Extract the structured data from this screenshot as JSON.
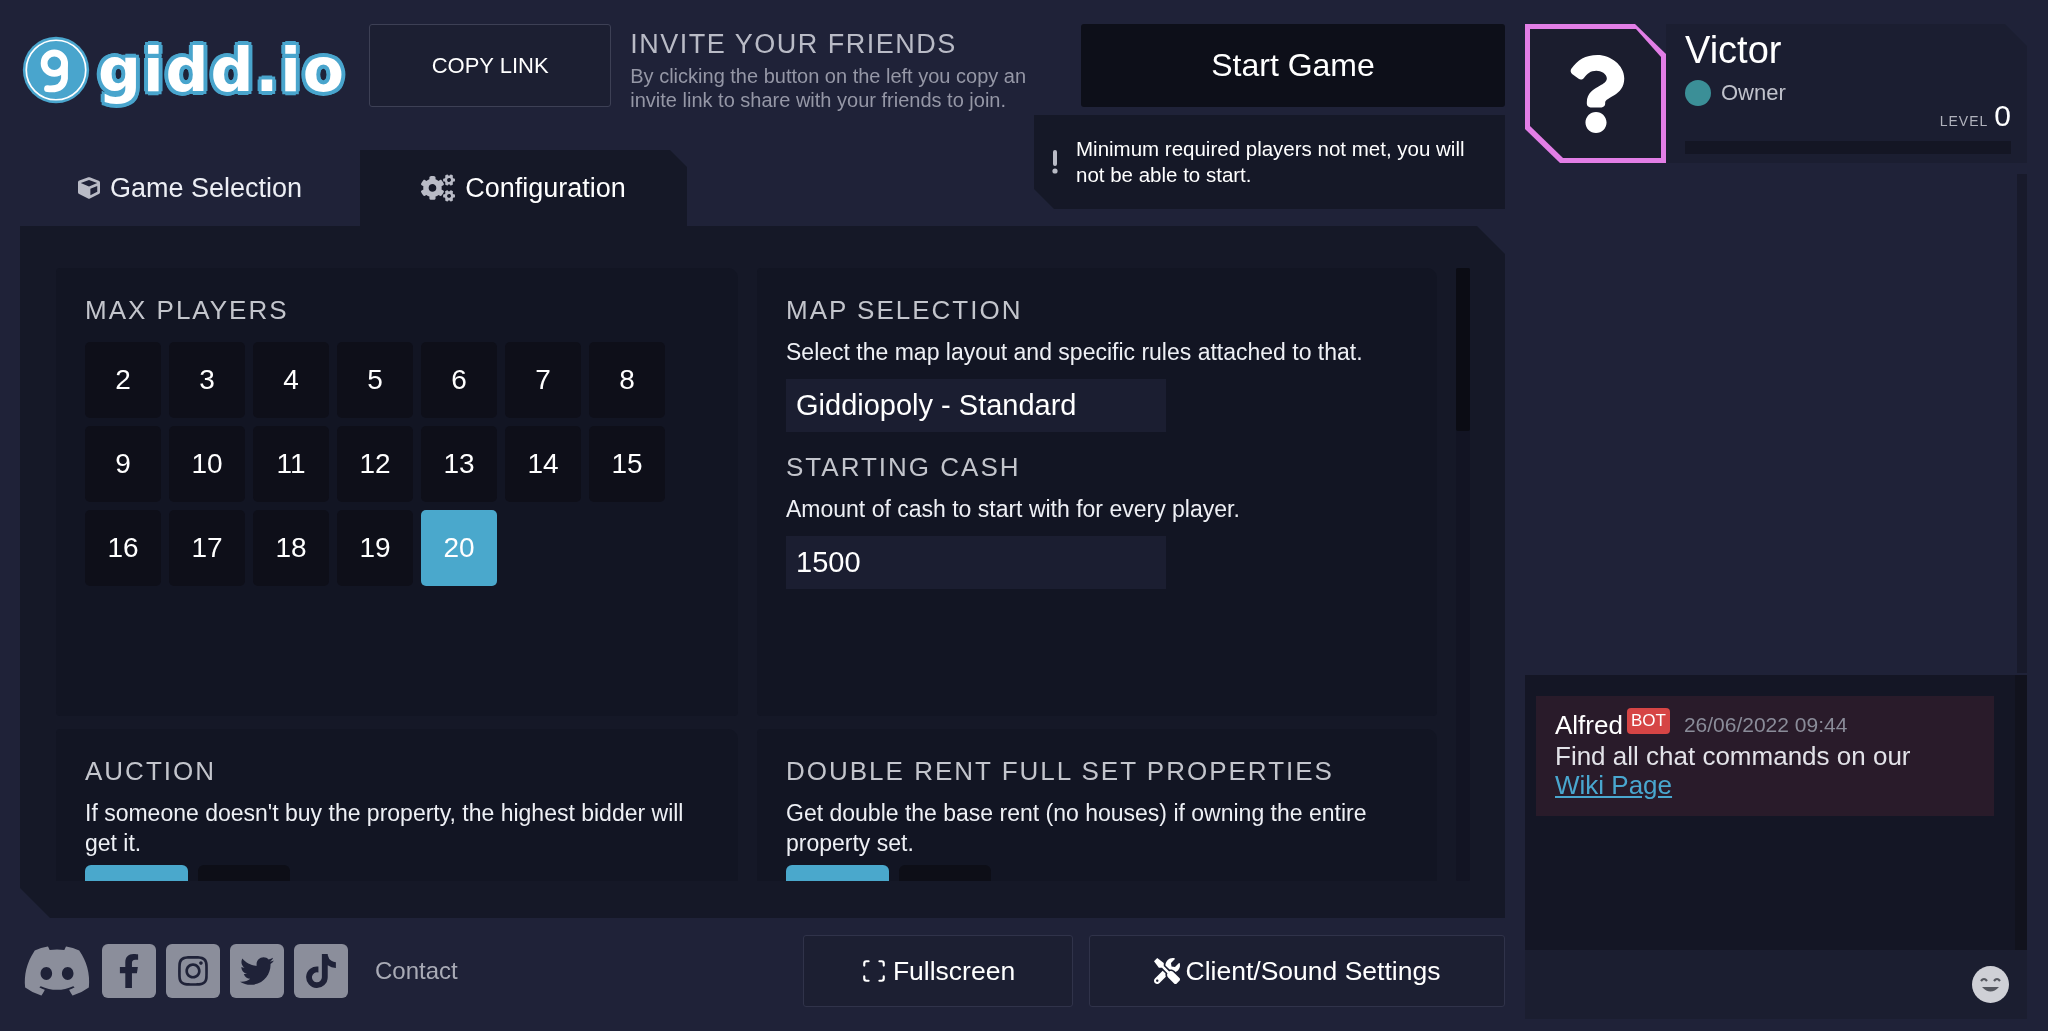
{
  "logo": {
    "text": "gidd.io"
  },
  "invite": {
    "button": "COPY LINK",
    "title": "INVITE YOUR FRIENDS",
    "description": "By clicking the button on the left you copy an invite link to share with your friends to join."
  },
  "start": {
    "button": "Start Game",
    "warning": "Minimum required players not met, you will not be able to start."
  },
  "tabs": [
    {
      "label": "Game Selection",
      "selected": false
    },
    {
      "label": "Configuration",
      "selected": true
    }
  ],
  "cards": [
    {
      "sections": [
        {
          "kind": "choice",
          "title": "MAX PLAYERS",
          "options": [
            {
              "label": "2",
              "selected": false
            },
            {
              "label": "3",
              "selected": false
            },
            {
              "label": "4",
              "selected": false
            },
            {
              "label": "5",
              "selected": false
            },
            {
              "label": "6",
              "selected": false
            },
            {
              "label": "7",
              "selected": false
            },
            {
              "label": "8",
              "selected": false
            },
            {
              "label": "9",
              "selected": false
            },
            {
              "label": "10",
              "selected": false
            },
            {
              "label": "11",
              "selected": false
            },
            {
              "label": "12",
              "selected": false
            },
            {
              "label": "13",
              "selected": false
            },
            {
              "label": "14",
              "selected": false
            },
            {
              "label": "15",
              "selected": false
            },
            {
              "label": "16",
              "selected": false
            },
            {
              "label": "17",
              "selected": false
            },
            {
              "label": "18",
              "selected": false
            },
            {
              "label": "19",
              "selected": false
            },
            {
              "label": "20",
              "selected": true
            }
          ]
        }
      ]
    },
    {
      "sections": [
        {
          "kind": "field",
          "title": "MAP SELECTION",
          "description": "Select the map layout and specific rules attached to that.",
          "value": "Giddiopoly - Standard"
        },
        {
          "kind": "field",
          "title": "STARTING CASH",
          "description": "Amount of cash to start with for every player.",
          "value": "1500"
        }
      ]
    },
    {
      "sections": [
        {
          "kind": "toggle",
          "title": "AUCTION",
          "description": "If someone doesn't buy the property, the highest bidder will get it.",
          "options": [
            {
              "selected": true
            },
            {
              "selected": false
            }
          ]
        }
      ]
    },
    {
      "sections": [
        {
          "kind": "toggle",
          "title": "DOUBLE RENT FULL SET PROPERTIES",
          "description": "Get double the base rent (no houses) if owning the entire property set.",
          "options": [
            {
              "selected": true
            },
            {
              "selected": false
            }
          ]
        }
      ]
    }
  ],
  "footer": {
    "contact": "Contact",
    "buttons": [
      "Fullscreen",
      "Client/Sound Settings"
    ]
  },
  "user": {
    "name": "Victor",
    "role": "Owner",
    "level_label": "LEVEL",
    "level_value": "0"
  },
  "chat": {
    "messages": [
      {
        "author": "Alfred",
        "badge": "BOT",
        "time": "26/06/2022 09:44",
        "text": "Find all chat commands on our",
        "link": "Wiki Page"
      }
    ]
  }
}
